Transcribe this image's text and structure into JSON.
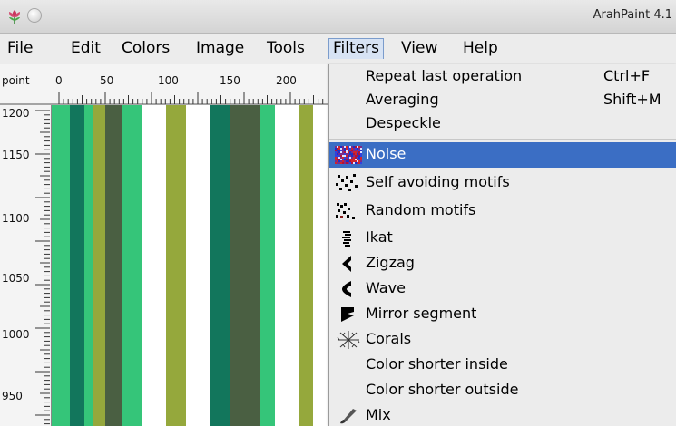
{
  "window": {
    "title": "ArahPaint 4.1"
  },
  "menubar": {
    "items": [
      {
        "label": "File"
      },
      {
        "label": "Edit"
      },
      {
        "label": "Colors"
      },
      {
        "label": "Image"
      },
      {
        "label": "Tools"
      },
      {
        "label": "Filters",
        "active": true
      },
      {
        "label": "View"
      },
      {
        "label": "Help"
      }
    ]
  },
  "ruler": {
    "unit": "point",
    "h_labels": [
      "0",
      "50",
      "100",
      "150",
      "200"
    ],
    "v_labels": [
      "1200",
      "1150",
      "1100",
      "1050",
      "1000",
      "950"
    ]
  },
  "canvas": {
    "stripe_colors": [
      "#35c579",
      "#12765c",
      "#35c579",
      "#95a83c",
      "#4a5f42",
      "#35c579",
      "#ffffff",
      "#95a83c",
      "#ffffff",
      "#12765c",
      "#4a5f42",
      "#35c579",
      "#ffffff",
      "#95a83c",
      "#ffffff"
    ]
  },
  "filters_menu": {
    "items": [
      {
        "label": "Repeat last operation",
        "shortcut": "Ctrl+F",
        "icon": ""
      },
      {
        "label": "Averaging",
        "shortcut": "Shift+M",
        "icon": ""
      },
      {
        "label": "Despeckle",
        "shortcut": "",
        "icon": ""
      },
      {
        "label": "Noise",
        "shortcut": "",
        "icon": "noise-icon",
        "highlighted": true
      },
      {
        "label": "Self avoiding motifs",
        "shortcut": "",
        "icon": "self-avoiding-motifs-icon"
      },
      {
        "label": "Random motifs",
        "shortcut": "",
        "icon": "random-motifs-icon"
      },
      {
        "label": "Ikat",
        "shortcut": "",
        "icon": "ikat-icon"
      },
      {
        "label": "Zigzag",
        "shortcut": "",
        "icon": "zigzag-icon"
      },
      {
        "label": "Wave",
        "shortcut": "",
        "icon": "wave-icon"
      },
      {
        "label": "Mirror segment",
        "shortcut": "",
        "icon": "mirror-segment-icon"
      },
      {
        "label": "Corals",
        "shortcut": "",
        "icon": "corals-icon"
      },
      {
        "label": "Color shorter inside",
        "shortcut": "",
        "icon": ""
      },
      {
        "label": "Color shorter outside",
        "shortcut": "",
        "icon": ""
      },
      {
        "label": "Mix",
        "shortcut": "",
        "icon": "mix-icon"
      }
    ]
  },
  "colors": {
    "highlight": "#3b6ec4",
    "menubar_bg": "#ececec"
  }
}
